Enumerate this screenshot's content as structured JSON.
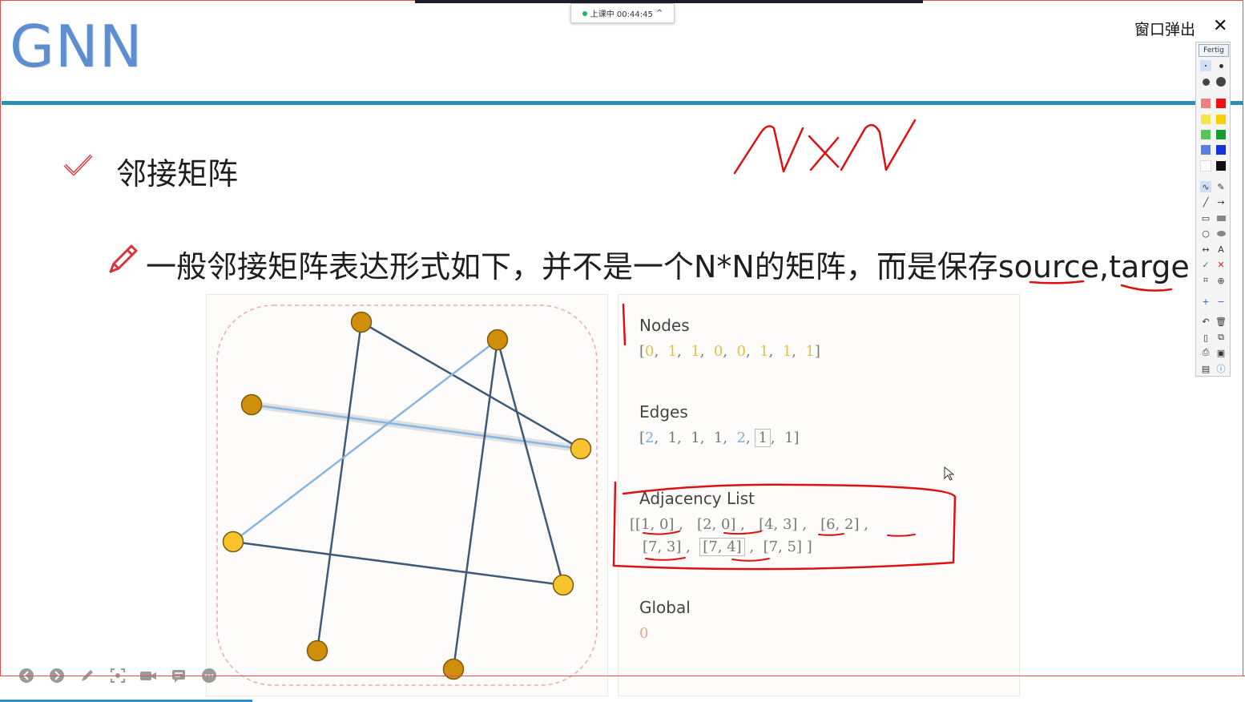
{
  "status": {
    "text": "上课中 00:44:45",
    "caret": "^"
  },
  "window": {
    "popout_label": "窗口弹出",
    "close_glyph": "✕"
  },
  "slide": {
    "title": "GNN",
    "bullet1": "邻接矩阵",
    "bullet2": "一般邻接矩阵表达形式如下，并不是一个N*N的矩阵，而是保存source,targe"
  },
  "data_panel": {
    "nodes_title": "Nodes",
    "nodes_values": [
      "0",
      "1",
      "1",
      "0",
      "0",
      "1",
      "1",
      "1"
    ],
    "edges_title": "Edges",
    "edges_values": [
      "2",
      "1",
      "1",
      "1",
      "2",
      "1",
      "1"
    ],
    "adjacency_title": "Adjacency List",
    "adjacency_row1": [
      "[1, 0]",
      "[2, 0]",
      "[4, 3]",
      "[6, 2]"
    ],
    "adjacency_row2": [
      "[7, 3]",
      "[7, 4]",
      "[7, 5]"
    ],
    "global_title": "Global",
    "global_value": "0"
  },
  "graph": {
    "nodes": [
      {
        "id": 0,
        "value": 0
      },
      {
        "id": 1,
        "value": 1
      },
      {
        "id": 2,
        "value": 1
      },
      {
        "id": 3,
        "value": 0
      },
      {
        "id": 4,
        "value": 0
      },
      {
        "id": 5,
        "value": 1
      },
      {
        "id": 6,
        "value": 1
      },
      {
        "id": 7,
        "value": 1
      }
    ],
    "edges": [
      {
        "source": 1,
        "target": 0,
        "value": 2
      },
      {
        "source": 2,
        "target": 0,
        "value": 1
      },
      {
        "source": 4,
        "target": 3,
        "value": 1
      },
      {
        "source": 6,
        "target": 2,
        "value": 1
      },
      {
        "source": 7,
        "target": 3,
        "value": 2
      },
      {
        "source": 7,
        "target": 4,
        "value": 1
      },
      {
        "source": 7,
        "target": 5,
        "value": 1
      }
    ],
    "colors": {
      "node_dark": "#d08f0a",
      "node_light": "#f7c52b",
      "edge_dark": "#3d5a78",
      "edge_light": "#86b6e2",
      "boundary": "#f0a9a9"
    }
  },
  "toolbar": {
    "done_label": "Fertig",
    "swatches": [
      "#f08080",
      "#ee1111",
      "#f2e64a",
      "#f7d000",
      "#56c456",
      "#12a02b",
      "#5a7fe0",
      "#1133dd",
      "#ffffff",
      "#111111"
    ],
    "text_tool": "A"
  },
  "annotation_colors": {
    "ink": "#dd1111"
  }
}
